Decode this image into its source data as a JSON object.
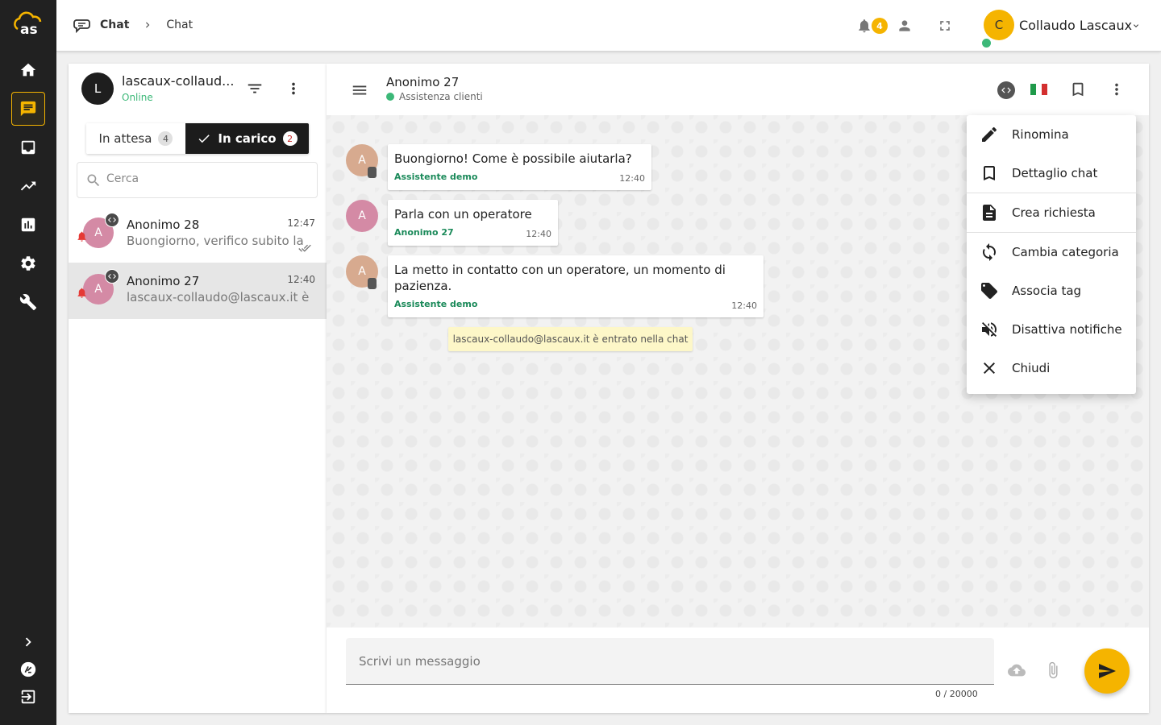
{
  "breadcrumb": {
    "first": "Chat",
    "second": "Chat"
  },
  "topbar": {
    "notification_count": "4",
    "user_initial": "C",
    "user_name": "Collaudo Lascaux"
  },
  "sidebar_nav": [
    "home",
    "chat",
    "inbox",
    "trending",
    "reports",
    "settings",
    "tools"
  ],
  "agent": {
    "initial": "L",
    "name": "lascaux-collaud...",
    "status": "Online"
  },
  "tabs": {
    "waiting_label": "In attesa",
    "waiting_count": "4",
    "taken_label": "In carico",
    "taken_count": "2"
  },
  "search": {
    "placeholder": "Cerca"
  },
  "conversations": [
    {
      "initial": "A",
      "title": "Anonimo 28",
      "time": "12:47",
      "preview": "Buongiorno, verifico subito la"
    },
    {
      "initial": "A",
      "title": "Anonimo 27",
      "time": "12:40",
      "preview": "lascaux-collaudo@lascaux.it è"
    }
  ],
  "chat": {
    "title": "Anonimo 27",
    "subtitle": "Assistenza clienti",
    "messages": [
      {
        "initial": "A",
        "text": "Buongiorno! Come è possibile aiutarla?",
        "author": "Assistente demo",
        "time": "12:40"
      },
      {
        "initial": "A",
        "text": "Parla con un operatore",
        "author": "Anonimo 27",
        "time": "12:40"
      },
      {
        "initial": "A",
        "text": "La metto in contatto con un operatore, un momento di pazienza.",
        "author": "Assistente demo",
        "time": "12:40"
      }
    ],
    "system_note": "lascaux-collaudo@lascaux.it è entrato nella chat"
  },
  "composer": {
    "placeholder": "Scrivi un messaggio",
    "counter": "0 / 20000"
  },
  "menu": {
    "items": [
      "Rinomina",
      "Dettaglio chat",
      "Crea richiesta",
      "Cambia categoria",
      "Associa tag",
      "Disattiva notifiche",
      "Chiudi"
    ]
  },
  "colors": {
    "accent": "#f5b400",
    "rail": "#212121",
    "online": "#3cb878",
    "author": "#1b8a5a",
    "alert": "#e53935"
  }
}
